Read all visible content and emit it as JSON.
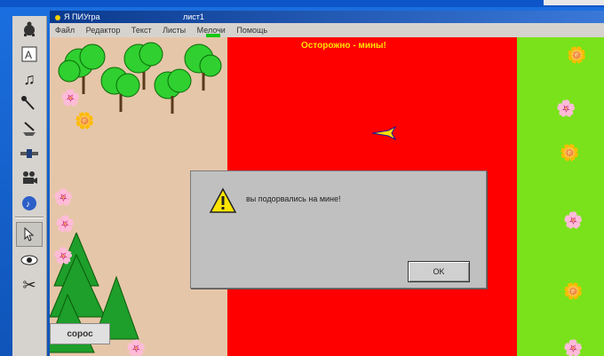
{
  "window": {
    "title": "Я ПИУгра",
    "document": "лист1"
  },
  "menu": [
    "Файл",
    "Редактор",
    "Текст",
    "Листы",
    "Мелочи",
    "Помощь"
  ],
  "stage": {
    "caution_text": "Осторожно - мины!",
    "sprite_label": "сорос"
  },
  "dialog": {
    "message": "вы подорвались на мине!",
    "ok_label": "OK"
  },
  "colors": {
    "red_field": "#ff0000",
    "green_field": "#79e21a",
    "beige_field": "#e6c6a8",
    "caution": "#ffe100"
  },
  "tools": [
    "turtle-icon",
    "text-icon",
    "music-note-icon",
    "microphone-icon",
    "scanner-icon",
    "slider-icon",
    "camera-icon",
    "cd-icon",
    "pointer-icon",
    "eye-icon",
    "scissors-icon"
  ]
}
